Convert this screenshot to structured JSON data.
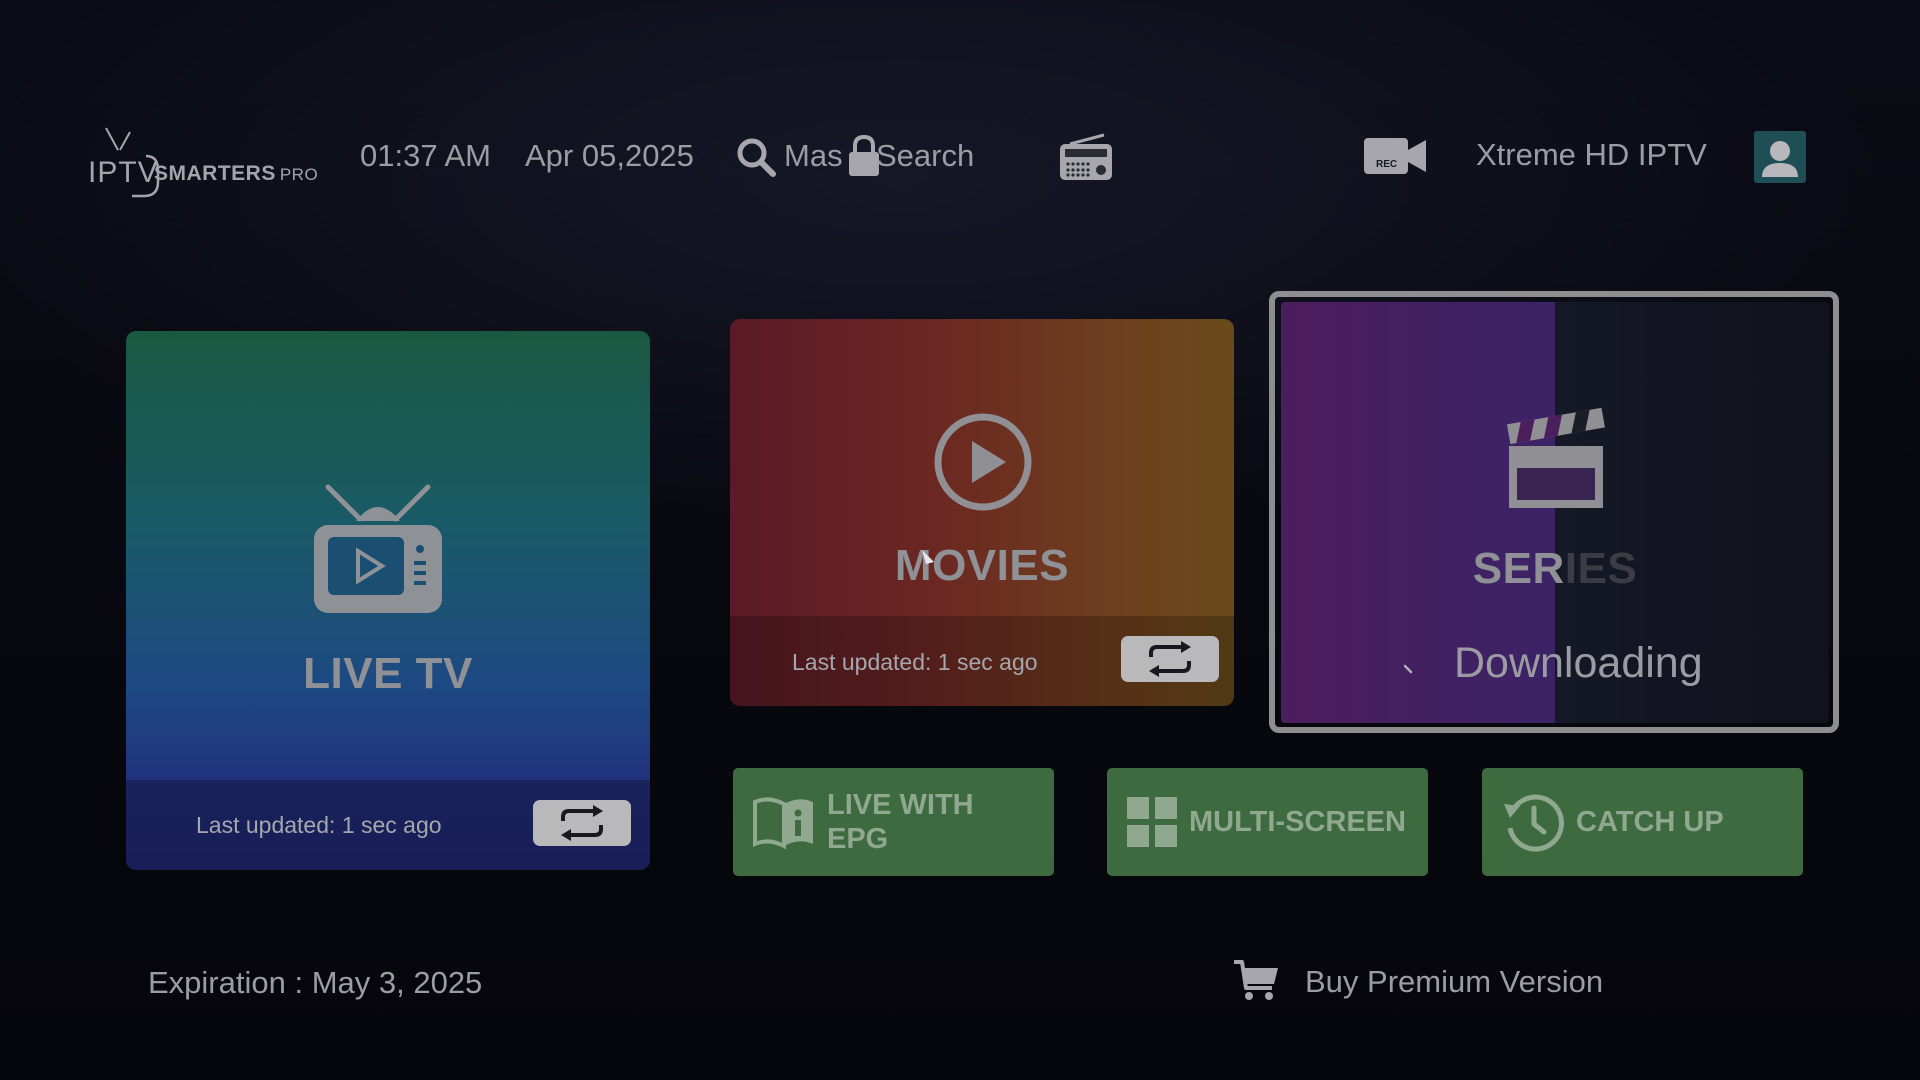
{
  "header": {
    "logo": {
      "iptv": "IPTV",
      "smarters": "SMARTERS",
      "pro": "PRO"
    },
    "time": "01:37 AM",
    "date": "Apr 05,2025",
    "master_search_prefix": "Mas",
    "master_search_suffix": " Search",
    "rec_icon_label": "REC",
    "account_name": "Xtreme HD IPTV"
  },
  "tiles": {
    "live_tv": {
      "label": "LIVE TV",
      "last_updated": "Last updated: 1 sec ago"
    },
    "movies": {
      "label": "MOVIES",
      "last_updated": "Last updated: 1 sec ago"
    },
    "series": {
      "label_left": "SER",
      "label_right": "IES",
      "status": "Downloading"
    }
  },
  "buttons": {
    "live_with_epg": {
      "line1": "LIVE WITH",
      "line2": "EPG"
    },
    "multi_screen": {
      "label": "MULTI-SCREEN"
    },
    "catch_up": {
      "label": "CATCH UP"
    }
  },
  "footer": {
    "expiration": "Expiration : May 3, 2025",
    "buy_premium": "Buy Premium Version"
  },
  "colors": {
    "background": "#07080f",
    "live_tv_top": "#1a5940",
    "live_tv_bottom": "#23297a",
    "movies_left": "#5a1a27",
    "movies_right": "#6a4a1b",
    "series_left": "#4d1d5e",
    "action_button": "#3d6a3e",
    "focus_border": "#8e8e91"
  }
}
